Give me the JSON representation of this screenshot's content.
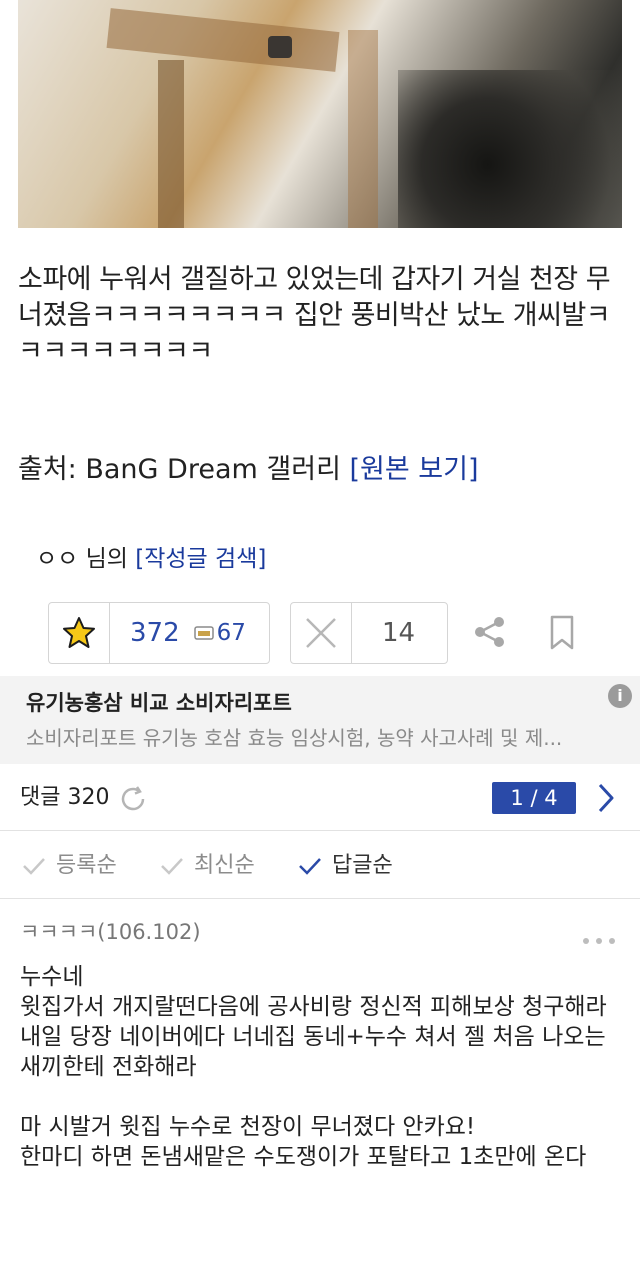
{
  "post": {
    "body": "소파에 누워서 갤질하고 있었는데 갑자기 거실 천장 무너졌음ㅋㅋㅋㅋㅋㅋㅋㅋ 집안 풍비박산 났노 개씨발ㅋㅋㅋㅋㅋㅋㅋㅋㅋ",
    "source_prefix": "출처: BanG Dream 갤러리 ",
    "source_link": "[원본 보기]",
    "author_name": "ㅇㅇ 님의 ",
    "author_link": "[작성글 검색]"
  },
  "votes": {
    "up_count": "372",
    "comment_count": "67",
    "down_count": "14"
  },
  "ad": {
    "title": "유기농홍삼 비교 소비자리포트",
    "description": "소비자리포트 유기농 호삼 효능 임상시험, 농약 사고사례 및 제...",
    "info_icon": "i"
  },
  "comments": {
    "count_label": "댓글 320",
    "pager": "1 / 4",
    "sort_options": [
      "등록순",
      "최신순",
      "답글순"
    ],
    "active_sort": "답글순",
    "first": {
      "author": "ㅋㅋㅋㅋ(106.102)",
      "body": "누수네\n윗집가서 개지랄떤다음에 공사비랑 정신적 피해보상 청구해라\n내일 당장 네이버에다 너네집 동네+누수 쳐서 젤 처음 나오는 새끼한테 전화해라\n\n마 시발거 윗집 누수로 천장이 무너졌다 안카요!\n한마디 하면 돈냄새맡은 수도쟁이가 포탈타고 1초만에 온다"
    }
  },
  "colors": {
    "accent": "#2a4aa8",
    "link": "#1a3a9c",
    "ad_bg": "#f3f3f3"
  }
}
